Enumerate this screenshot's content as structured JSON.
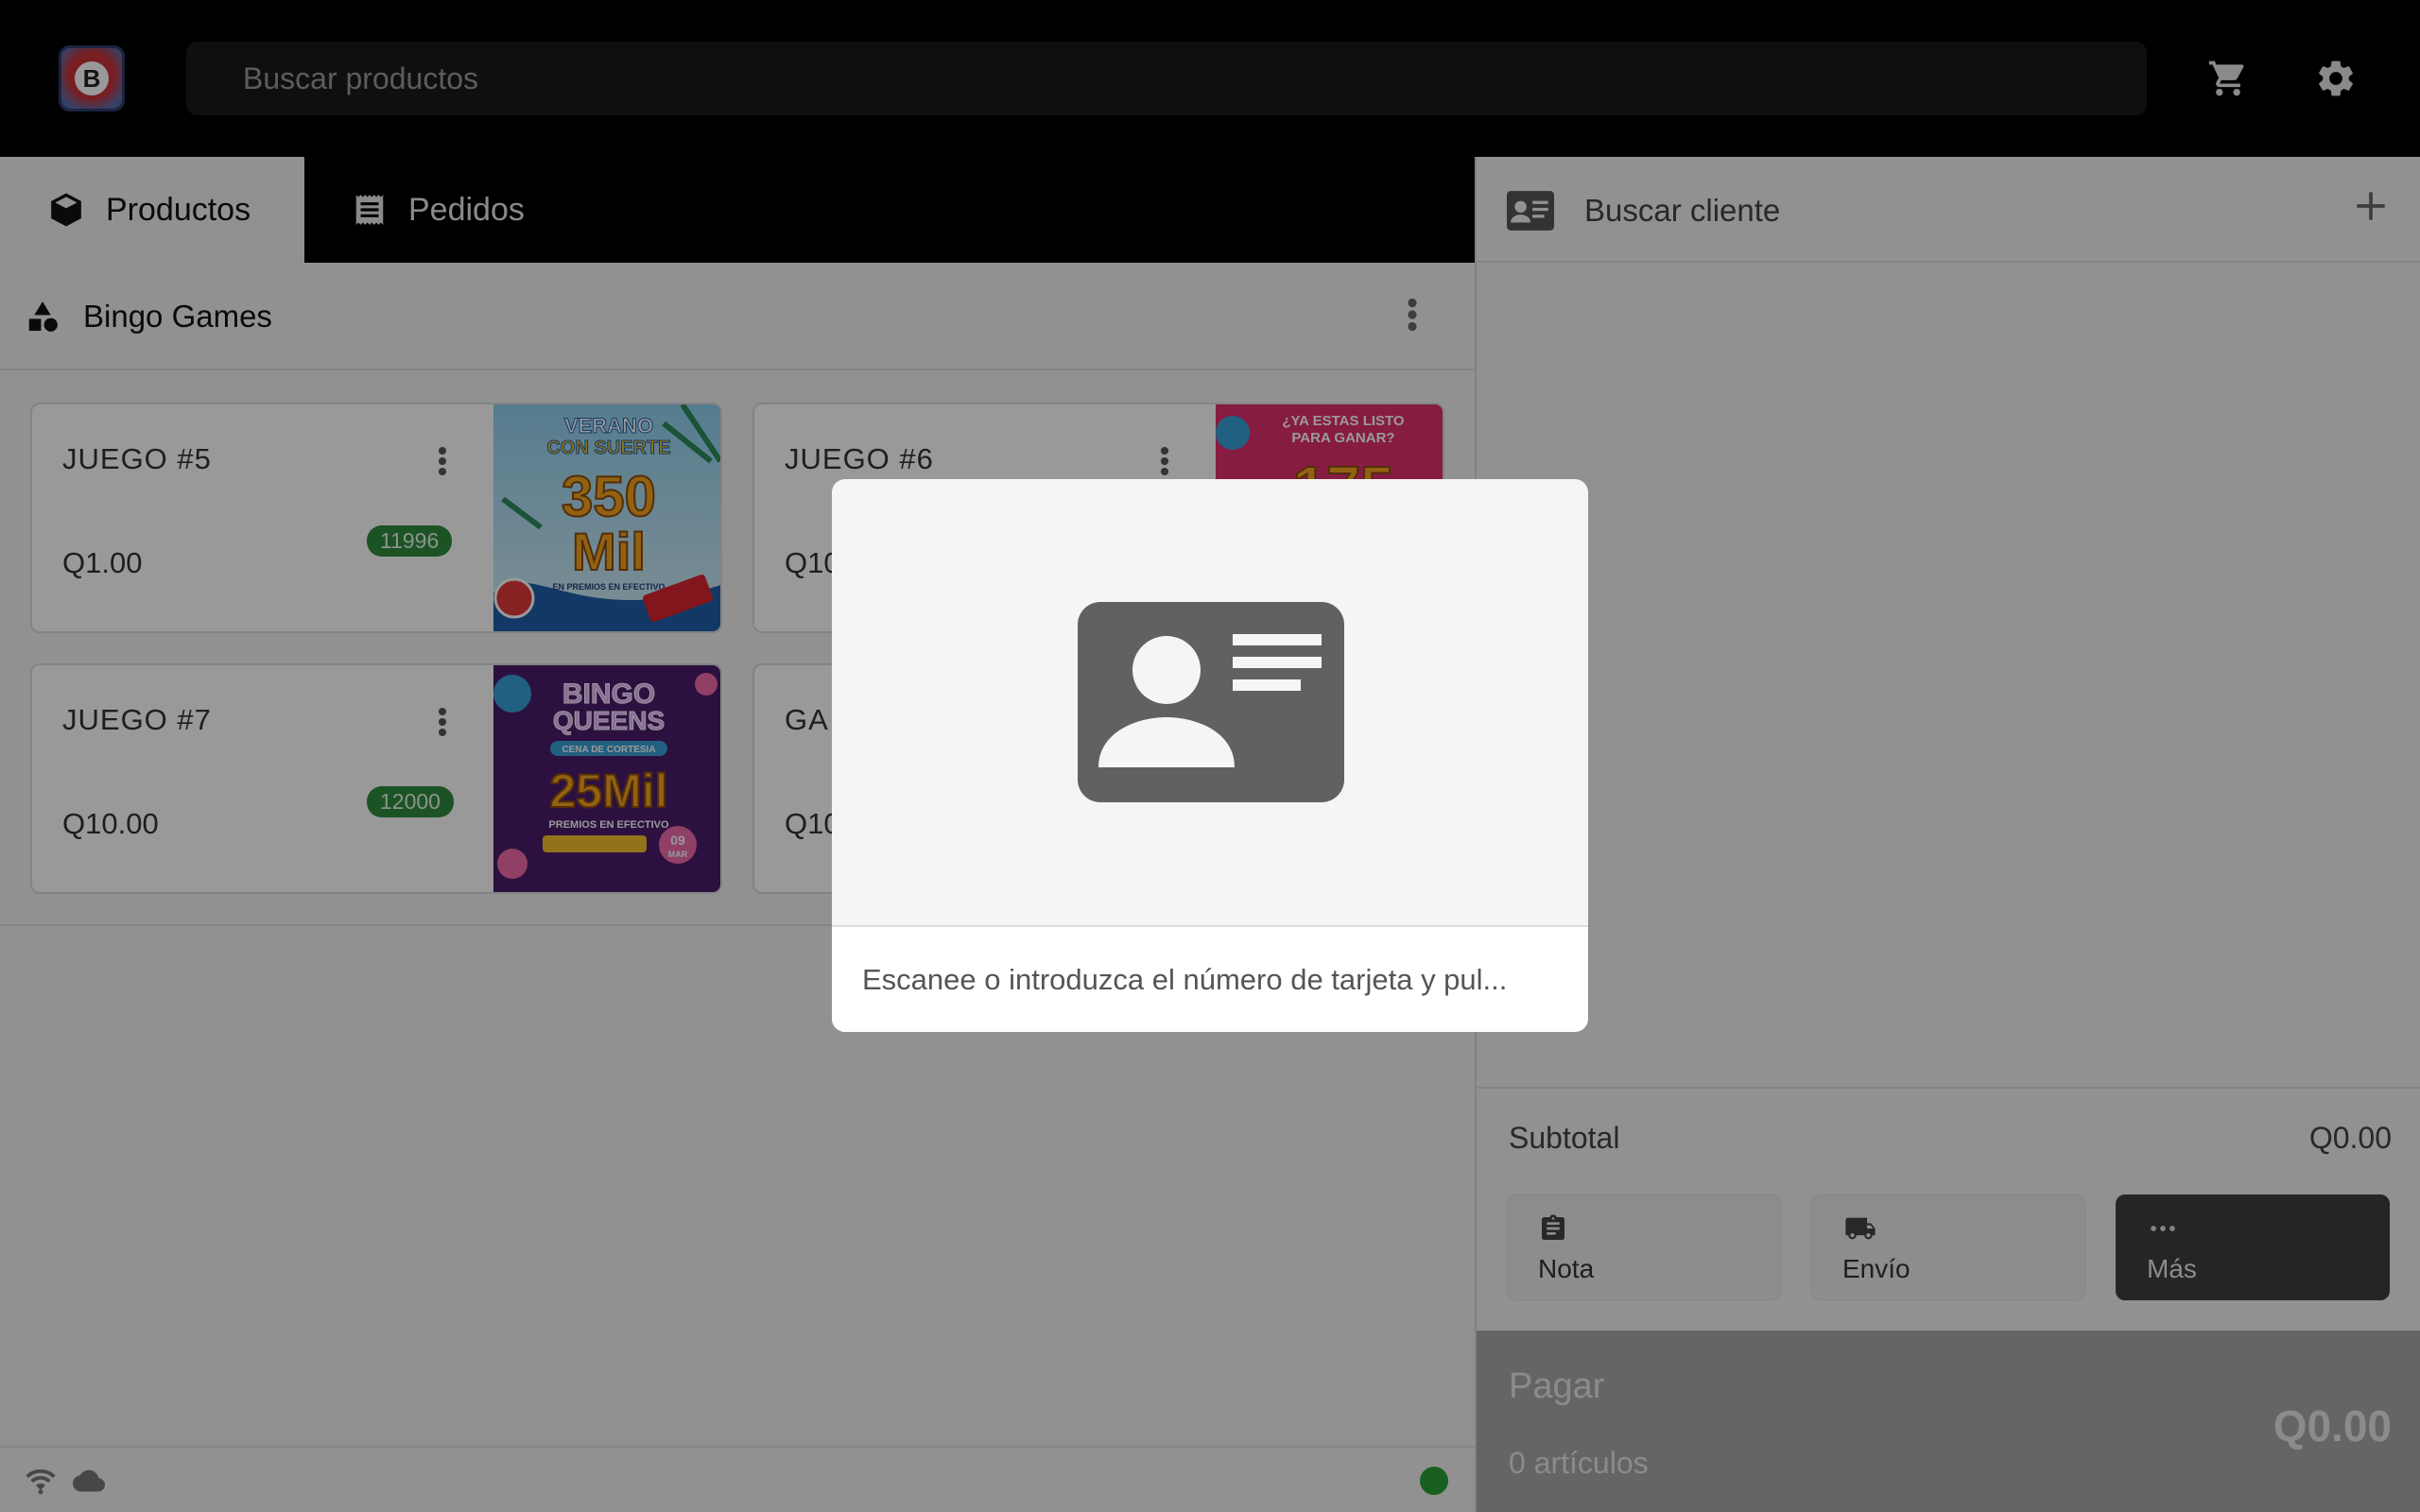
{
  "topbar": {
    "search_placeholder": "Buscar productos",
    "logo_letter": "B"
  },
  "tabs": [
    {
      "label": "Productos",
      "active": true,
      "icon": "box-icon"
    },
    {
      "label": "Pedidos",
      "active": false,
      "icon": "receipt-icon"
    }
  ],
  "category": {
    "title": "Bingo Games"
  },
  "products": [
    {
      "name": "JUEGO #5",
      "price": "Q1.00",
      "stock": "11996",
      "image": "verano-con-suerte-350-mil"
    },
    {
      "name": "JUEGO #6",
      "price": "Q10",
      "stock": "",
      "image": "ya-estas-listo-175"
    },
    {
      "name": "JUEGO #7",
      "price": "Q10.00",
      "stock": "12000",
      "image": "bingo-queens-25-mil"
    },
    {
      "name": "GA",
      "price": "Q10",
      "stock": "",
      "image": ""
    }
  ],
  "product_images": {
    "p1": {
      "line1": "VERANO",
      "line2": "CON SUERTE",
      "big": "350",
      "big2": "Mil",
      "small": "EN PREMIOS EN EFECTIVO"
    },
    "p2": {
      "line1": "¿YA ESTAS LISTO",
      "line2": "PARA GANAR?",
      "big": "175"
    },
    "p3": {
      "line1": "BINGO",
      "line2": "QUEENS",
      "tag": "CENA DE CORTESIA",
      "big": "25Mil",
      "small": "PREMIOS EN EFECTIVO",
      "date": "09",
      "month": "MAR"
    }
  },
  "customer": {
    "placeholder": "Buscar cliente"
  },
  "summary": {
    "subtotal_label": "Subtotal",
    "subtotal_value": "Q0.00"
  },
  "actions": [
    {
      "label": "Nota",
      "icon": "clipboard-icon"
    },
    {
      "label": "Envío",
      "icon": "truck-icon"
    },
    {
      "label": "Más",
      "icon": "more-icon"
    }
  ],
  "pay": {
    "title": "Pagar",
    "items": "0 artículos",
    "total": "Q0.00"
  },
  "modal": {
    "input_placeholder": "Escanee o introduzca el número de tarjeta y pul..."
  },
  "colors": {
    "badge": "#2f8a3f",
    "status_dot": "#2aa136",
    "modal_icon": "#616161"
  }
}
